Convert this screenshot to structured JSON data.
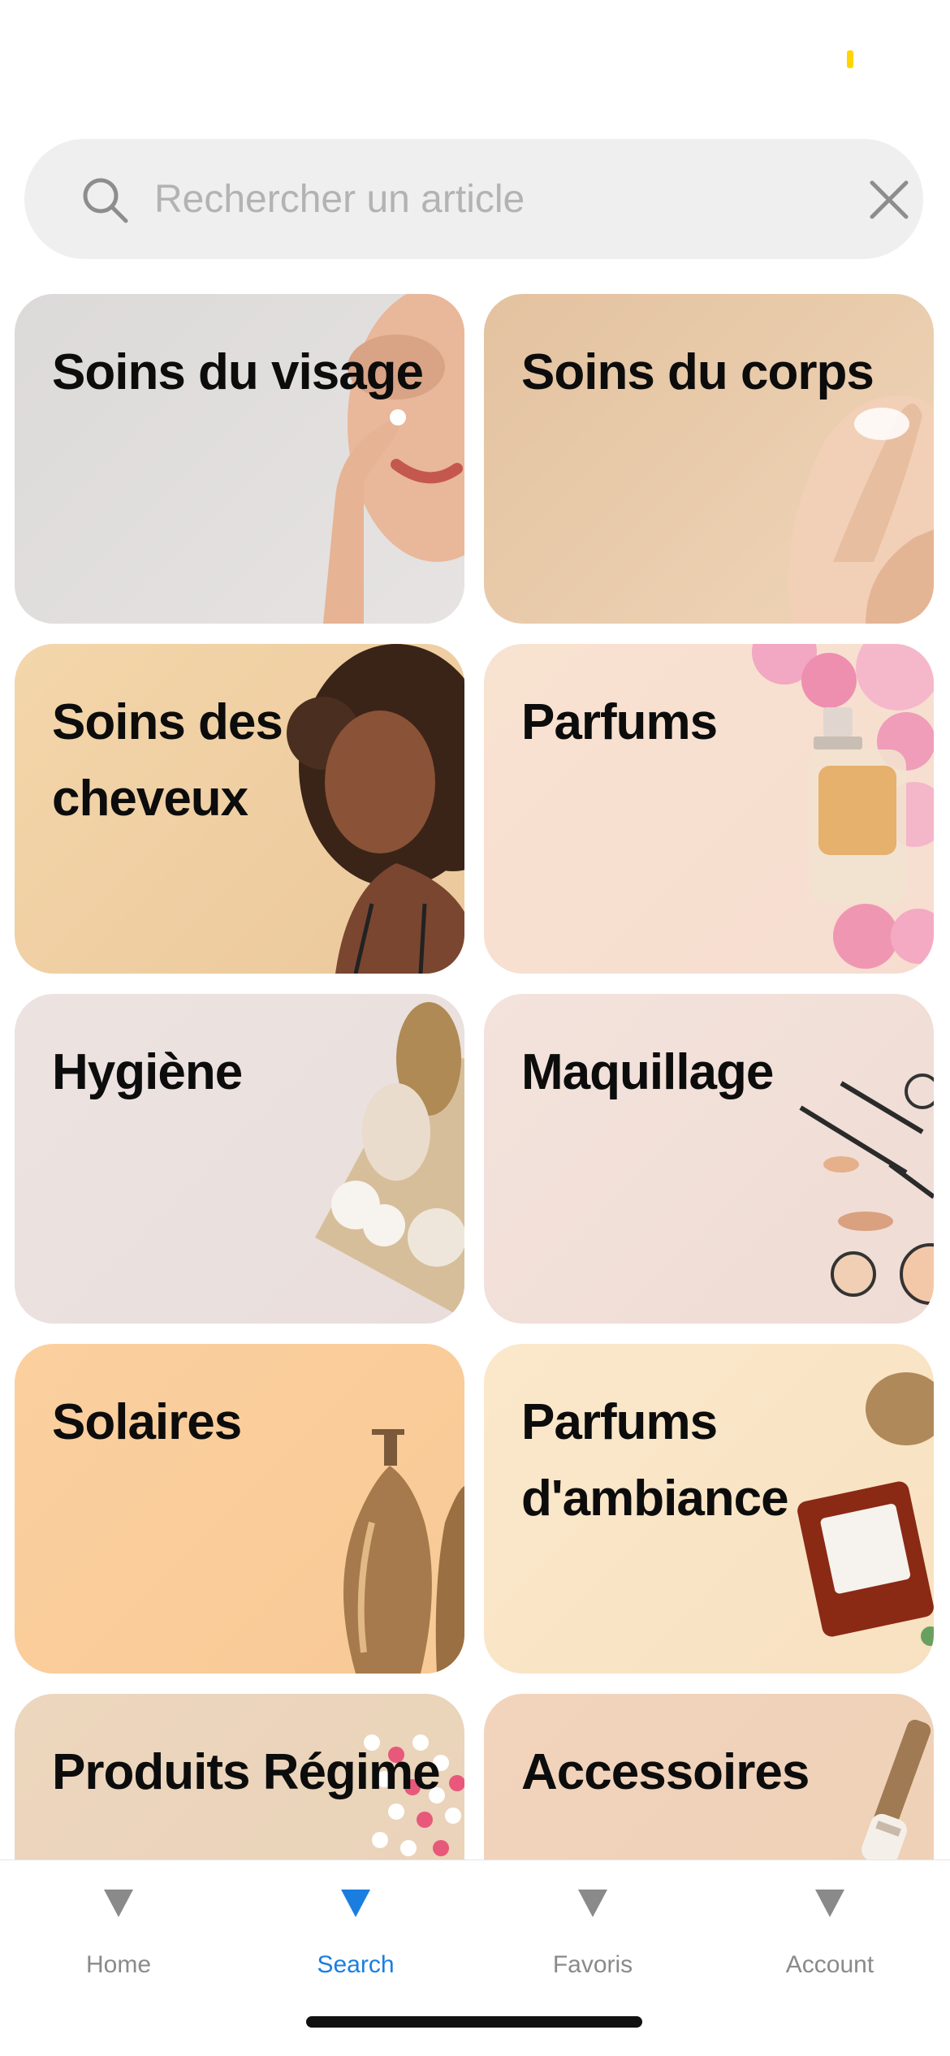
{
  "colors": {
    "accent": "#1a7ee0",
    "tab_inactive": "#8a8a8a",
    "status_indicator": "#ffd400",
    "search_bg": "#efefef",
    "title_text": "#0c0c0c"
  },
  "search": {
    "placeholder": "Rechercher un article",
    "value": "",
    "icon": "search-icon",
    "clear_icon": "close-icon"
  },
  "categories": [
    {
      "label": "Soins du visage"
    },
    {
      "label": "Soins du corps"
    },
    {
      "label": "Soins des cheveux"
    },
    {
      "label": "Parfums"
    },
    {
      "label": "Hygiène"
    },
    {
      "label": "Maquillage"
    },
    {
      "label": "Solaires"
    },
    {
      "label": "Parfums d'ambiance"
    },
    {
      "label": "Produits Régime"
    },
    {
      "label": "Accessoires"
    }
  ],
  "tabs": [
    {
      "label": "Home",
      "icon": "triangle-down-icon",
      "active": false
    },
    {
      "label": "Search",
      "icon": "triangle-down-icon",
      "active": true
    },
    {
      "label": "Favoris",
      "icon": "triangle-down-icon",
      "active": false
    },
    {
      "label": "Account",
      "icon": "triangle-down-icon",
      "active": false
    }
  ]
}
